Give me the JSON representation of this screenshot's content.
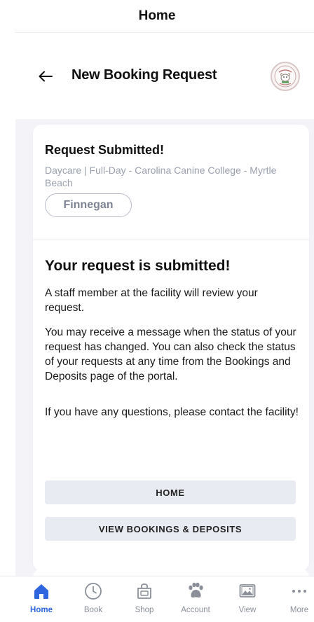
{
  "top_bar": {
    "title": "Home"
  },
  "header": {
    "title": "New Booking Request",
    "logo_text": "CAROLINA CANINE COLLEGE"
  },
  "request_card": {
    "title": "Request Submitted!",
    "service": "Daycare | Full-Day - Carolina Canine College - Myrtle Beach",
    "pet_name": "Finnegan",
    "confirmation_title": "Your request is submitted!",
    "paragraphs": [
      "A staff member at the facility will review your request.",
      "You may receive a message when the status of your request has changed. You can also check the status of your requests at any time from the Bookings and Deposits page of the portal.",
      "If you have any questions, please contact the facility!"
    ]
  },
  "actions": {
    "home_label": "HOME",
    "view_bookings_label": "VIEW BOOKINGS & DEPOSITS"
  },
  "tab_bar": {
    "active": "Home",
    "accent_color": "#2f66e0",
    "inactive_color": "#8a8f99",
    "items": [
      {
        "label": "Home",
        "icon": "home-icon"
      },
      {
        "label": "Book",
        "icon": "clock-icon"
      },
      {
        "label": "Shop",
        "icon": "shop-bag-icon"
      },
      {
        "label": "Account",
        "icon": "paw-icon"
      },
      {
        "label": "View",
        "icon": "image-icon"
      },
      {
        "label": "More",
        "icon": "more-dots-icon"
      }
    ]
  }
}
